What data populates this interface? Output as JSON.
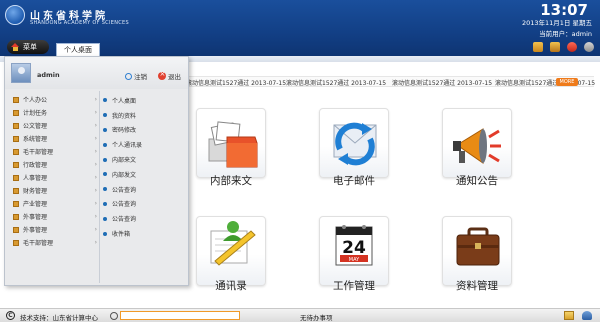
{
  "header": {
    "logo_cn": "山东省科学院",
    "logo_en": "SHANDONG ACADEMY OF SCIENCES",
    "time": "13:07",
    "date": "2013年11月1日 星期五",
    "user": "当前用户：admin"
  },
  "tabs": {
    "menu_label": "菜单",
    "active_tab": "个人桌面"
  },
  "panel": {
    "username": "admin",
    "logout": "注销",
    "quit": "退出",
    "menu_items": [
      "个人办公",
      "计划任务",
      "公文管理",
      "系统管理",
      "毛干部管理",
      "行政管理",
      "人事管理",
      "财务管理",
      "产业管理",
      "外事管理",
      "外事管理",
      "毛干部管理"
    ],
    "sub_items": [
      "个人桌面",
      "我的资料",
      "密码修改",
      "个人通讯录",
      "内部来文",
      "内部发文",
      "公告查询",
      "公告查询",
      "公告查询",
      "收件箱"
    ]
  },
  "ticker": {
    "items": [
      "滚动信息测试1527通过 2013-07-15",
      "滚动信息测试1527通过 2013-07-15",
      "滚动信息测试1527通过 2013-07-15",
      "滚动信息测试1527通过 2013-07-15"
    ],
    "more": "MORE"
  },
  "tiles": {
    "internal_doc": "内部来文",
    "email": "电子邮件",
    "notice": "通知公告",
    "contacts": "通讯录",
    "work_mgmt": "工作管理",
    "data_mgmt": "资料管理"
  },
  "calendar": {
    "month": "MAY",
    "day": "24"
  },
  "footer": {
    "support": "技术支持：山东省计算中心",
    "pending": "无待办事项"
  }
}
